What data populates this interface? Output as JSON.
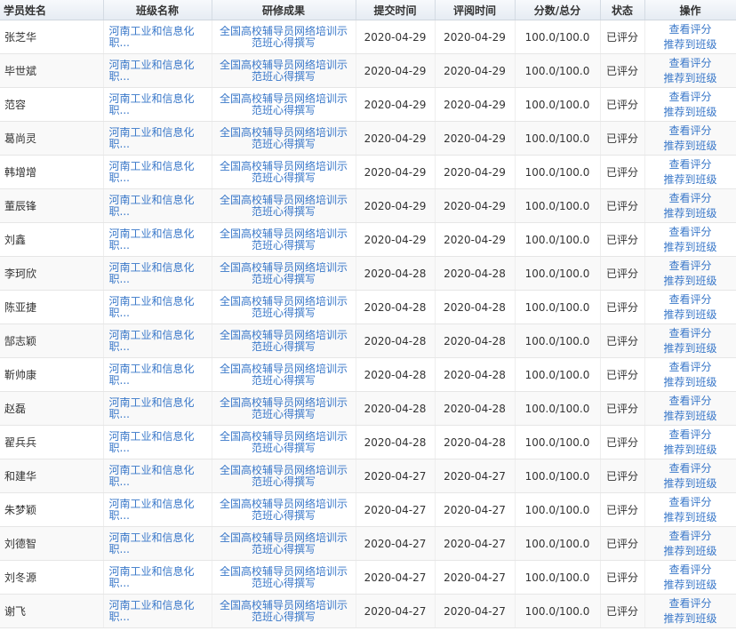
{
  "table": {
    "headers": {
      "name": "学员姓名",
      "class": "班级名称",
      "result": "研修成果",
      "submit_time": "提交时间",
      "review_time": "评阅时间",
      "score": "分数/总分",
      "status": "状态",
      "ops": "操作"
    },
    "rows": [
      {
        "name": "张芝华",
        "class": "河南工业和信息化职...",
        "result": "全国高校辅导员网络培训示范班心得撰写",
        "submit": "2020-04-29",
        "review": "2020-04-29",
        "score": "100.0/100.0",
        "status": "已评分",
        "view": "查看评分",
        "recommend": "推荐到班级"
      },
      {
        "name": "毕世斌",
        "class": "河南工业和信息化职...",
        "result": "全国高校辅导员网络培训示范班心得撰写",
        "submit": "2020-04-29",
        "review": "2020-04-29",
        "score": "100.0/100.0",
        "status": "已评分",
        "view": "查看评分",
        "recommend": "推荐到班级"
      },
      {
        "name": "范容",
        "class": "河南工业和信息化职...",
        "result": "全国高校辅导员网络培训示范班心得撰写",
        "submit": "2020-04-29",
        "review": "2020-04-29",
        "score": "100.0/100.0",
        "status": "已评分",
        "view": "查看评分",
        "recommend": "推荐到班级"
      },
      {
        "name": "葛尚灵",
        "class": "河南工业和信息化职...",
        "result": "全国高校辅导员网络培训示范班心得撰写",
        "submit": "2020-04-29",
        "review": "2020-04-29",
        "score": "100.0/100.0",
        "status": "已评分",
        "view": "查看评分",
        "recommend": "推荐到班级"
      },
      {
        "name": "韩增增",
        "class": "河南工业和信息化职...",
        "result": "全国高校辅导员网络培训示范班心得撰写",
        "submit": "2020-04-29",
        "review": "2020-04-29",
        "score": "100.0/100.0",
        "status": "已评分",
        "view": "查看评分",
        "recommend": "推荐到班级"
      },
      {
        "name": "董辰锋",
        "class": "河南工业和信息化职...",
        "result": "全国高校辅导员网络培训示范班心得撰写",
        "submit": "2020-04-29",
        "review": "2020-04-29",
        "score": "100.0/100.0",
        "status": "已评分",
        "view": "查看评分",
        "recommend": "推荐到班级"
      },
      {
        "name": "刘鑫",
        "class": "河南工业和信息化职...",
        "result": "全国高校辅导员网络培训示范班心得撰写",
        "submit": "2020-04-29",
        "review": "2020-04-29",
        "score": "100.0/100.0",
        "status": "已评分",
        "view": "查看评分",
        "recommend": "推荐到班级"
      },
      {
        "name": "李珂欣",
        "class": "河南工业和信息化职...",
        "result": "全国高校辅导员网络培训示范班心得撰写",
        "submit": "2020-04-28",
        "review": "2020-04-28",
        "score": "100.0/100.0",
        "status": "已评分",
        "view": "查看评分",
        "recommend": "推荐到班级"
      },
      {
        "name": "陈亚捷",
        "class": "河南工业和信息化职...",
        "result": "全国高校辅导员网络培训示范班心得撰写",
        "submit": "2020-04-28",
        "review": "2020-04-28",
        "score": "100.0/100.0",
        "status": "已评分",
        "view": "查看评分",
        "recommend": "推荐到班级"
      },
      {
        "name": "郜志颖",
        "class": "河南工业和信息化职...",
        "result": "全国高校辅导员网络培训示范班心得撰写",
        "submit": "2020-04-28",
        "review": "2020-04-28",
        "score": "100.0/100.0",
        "status": "已评分",
        "view": "查看评分",
        "recommend": "推荐到班级"
      },
      {
        "name": "靳帅康",
        "class": "河南工业和信息化职...",
        "result": "全国高校辅导员网络培训示范班心得撰写",
        "submit": "2020-04-28",
        "review": "2020-04-28",
        "score": "100.0/100.0",
        "status": "已评分",
        "view": "查看评分",
        "recommend": "推荐到班级"
      },
      {
        "name": "赵磊",
        "class": "河南工业和信息化职...",
        "result": "全国高校辅导员网络培训示范班心得撰写",
        "submit": "2020-04-28",
        "review": "2020-04-28",
        "score": "100.0/100.0",
        "status": "已评分",
        "view": "查看评分",
        "recommend": "推荐到班级"
      },
      {
        "name": "翟兵兵",
        "class": "河南工业和信息化职...",
        "result": "全国高校辅导员网络培训示范班心得撰写",
        "submit": "2020-04-28",
        "review": "2020-04-28",
        "score": "100.0/100.0",
        "status": "已评分",
        "view": "查看评分",
        "recommend": "推荐到班级"
      },
      {
        "name": "和建华",
        "class": "河南工业和信息化职...",
        "result": "全国高校辅导员网络培训示范班心得撰写",
        "submit": "2020-04-27",
        "review": "2020-04-27",
        "score": "100.0/100.0",
        "status": "已评分",
        "view": "查看评分",
        "recommend": "推荐到班级"
      },
      {
        "name": "朱梦颖",
        "class": "河南工业和信息化职...",
        "result": "全国高校辅导员网络培训示范班心得撰写",
        "submit": "2020-04-27",
        "review": "2020-04-27",
        "score": "100.0/100.0",
        "status": "已评分",
        "view": "查看评分",
        "recommend": "推荐到班级"
      },
      {
        "name": "刘德智",
        "class": "河南工业和信息化职...",
        "result": "全国高校辅导员网络培训示范班心得撰写",
        "submit": "2020-04-27",
        "review": "2020-04-27",
        "score": "100.0/100.0",
        "status": "已评分",
        "view": "查看评分",
        "recommend": "推荐到班级"
      },
      {
        "name": "刘冬源",
        "class": "河南工业和信息化职...",
        "result": "全国高校辅导员网络培训示范班心得撰写",
        "submit": "2020-04-27",
        "review": "2020-04-27",
        "score": "100.0/100.0",
        "status": "已评分",
        "view": "查看评分",
        "recommend": "推荐到班级"
      },
      {
        "name": "谢飞",
        "class": "河南工业和信息化职...",
        "result": "全国高校辅导员网络培训示范班心得撰写",
        "submit": "2020-04-27",
        "review": "2020-04-27",
        "score": "100.0/100.0",
        "status": "已评分",
        "view": "查看评分",
        "recommend": "推荐到班级"
      }
    ]
  }
}
